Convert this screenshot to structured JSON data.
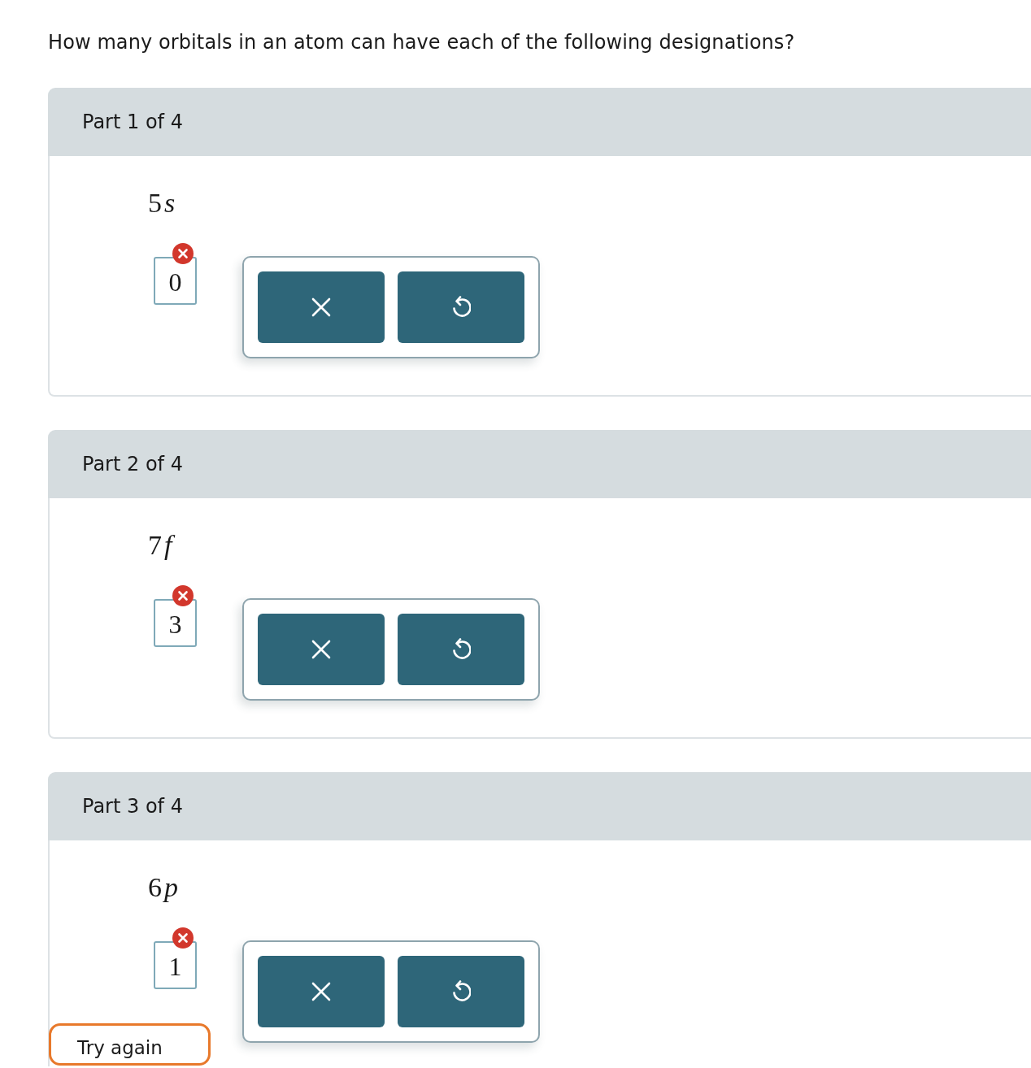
{
  "question": "How many orbitals in an atom can have each of the following designations?",
  "parts": [
    {
      "header": "Part 1 of 4",
      "designation": {
        "number": "5",
        "letter": "s"
      },
      "answer": "0",
      "incorrect": true
    },
    {
      "header": "Part 2 of 4",
      "designation": {
        "number": "7",
        "letter": "f"
      },
      "answer": "3",
      "incorrect": true
    },
    {
      "header": "Part 3 of 4",
      "designation": {
        "number": "6",
        "letter": "p"
      },
      "answer": "1",
      "incorrect": true
    }
  ],
  "try_again_button": {
    "label": "Try again"
  }
}
